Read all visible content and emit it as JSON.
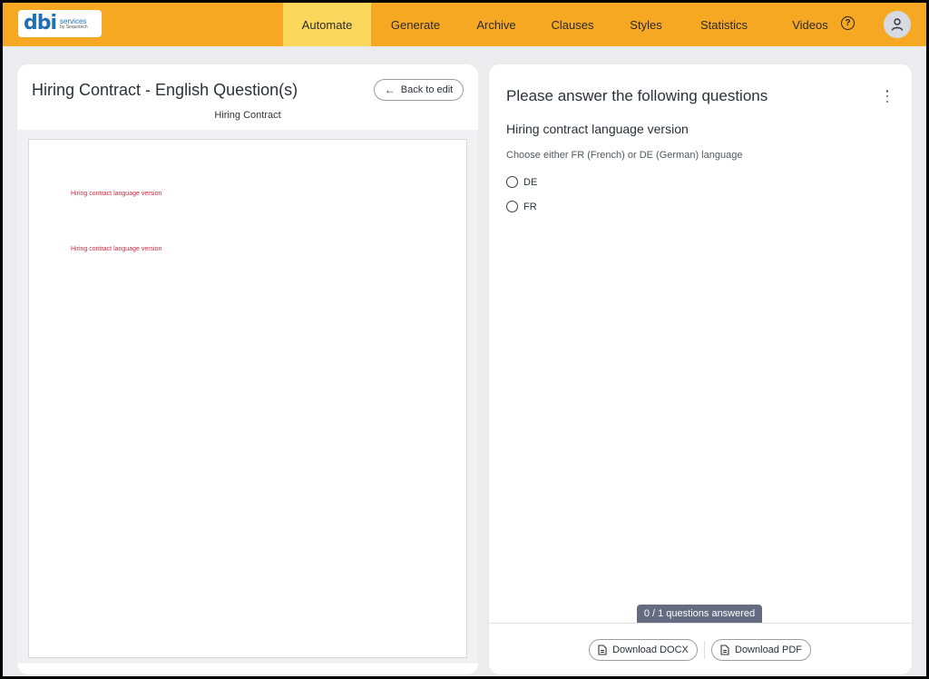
{
  "logo": {
    "main": "dbi",
    "line1": "services",
    "line2": "by Sequotech"
  },
  "nav": {
    "items": [
      {
        "label": "Automate",
        "active": true
      },
      {
        "label": "Generate"
      },
      {
        "label": "Archive"
      },
      {
        "label": "Clauses"
      },
      {
        "label": "Styles"
      },
      {
        "label": "Statistics"
      },
      {
        "label": "Videos"
      }
    ],
    "help_icon": "question-circle-icon",
    "avatar_icon": "user-icon"
  },
  "left": {
    "title": "Hiring Contract - English Question(s)",
    "back_button": "Back to edit",
    "doc_name": "Hiring Contract",
    "doc_lines": [
      "Hiring contract language version",
      "Hiring contract language version"
    ]
  },
  "right": {
    "title": "Please answer the following questions",
    "question_title": "Hiring contract language version",
    "question_desc": "Choose either FR (French) or DE (German) language",
    "options": [
      "DE",
      "FR"
    ],
    "progress": "0 / 1 questions answered",
    "download_docx": "Download DOCX",
    "download_pdf": "Download PDF"
  },
  "colors": {
    "nav_bg": "#f6a823",
    "nav_active": "#fbd75b",
    "doc_text": "#d8263e",
    "progress_bg": "#656c82"
  }
}
